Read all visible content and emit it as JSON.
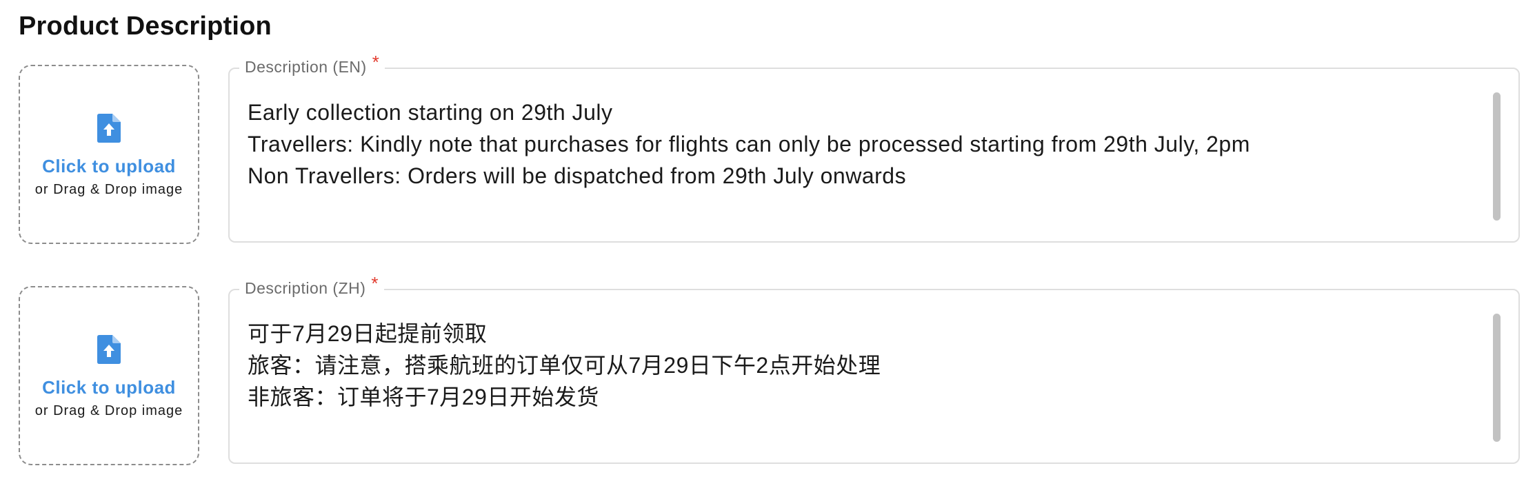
{
  "section": {
    "title": "Product Description"
  },
  "colors": {
    "accent_link": "#3f8fe0",
    "required_star": "#e23b2e",
    "field_border": "#dedede",
    "upload_border": "#8c8c8c"
  },
  "descriptions": [
    {
      "key": "en",
      "label": "Description (EN)",
      "required_mark": "*",
      "upload": {
        "icon": "file-upload-icon",
        "link_text": "Click to upload",
        "hint_text": "or Drag & Drop image"
      },
      "lines": [
        "Early collection starting on 29th July",
        "Travellers: Kindly note that purchases for flights can only be processed starting from 29th July, 2pm",
        "Non Travellers: Orders will be dispatched from 29th July onwards"
      ]
    },
    {
      "key": "zh",
      "label": "Description (ZH)",
      "required_mark": "*",
      "upload": {
        "icon": "file-upload-icon",
        "link_text": "Click to upload",
        "hint_text": "or Drag & Drop image"
      },
      "lines": [
        "可于7月29日起提前领取",
        "旅客：请注意，搭乘航班的订单仅可从7月29日下午2点开始处理",
        "非旅客：订单将于7月29日开始发货"
      ]
    }
  ]
}
